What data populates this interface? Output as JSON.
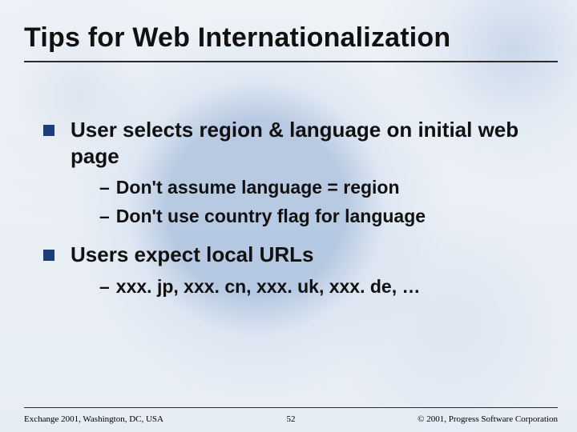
{
  "title": "Tips for Web Internationalization",
  "bullets": [
    {
      "text": "User selects region & language on initial web page",
      "subs": [
        "Don't assume language = region",
        "Don't use country flag for language"
      ]
    },
    {
      "text": "Users expect local URLs",
      "subs": [
        "xxx. jp, xxx. cn, xxx. uk, xxx. de, …"
      ]
    }
  ],
  "footer": {
    "left": "Exchange 2001, Washington, DC, USA",
    "center": "52",
    "right": "© 2001, Progress Software Corporation"
  }
}
